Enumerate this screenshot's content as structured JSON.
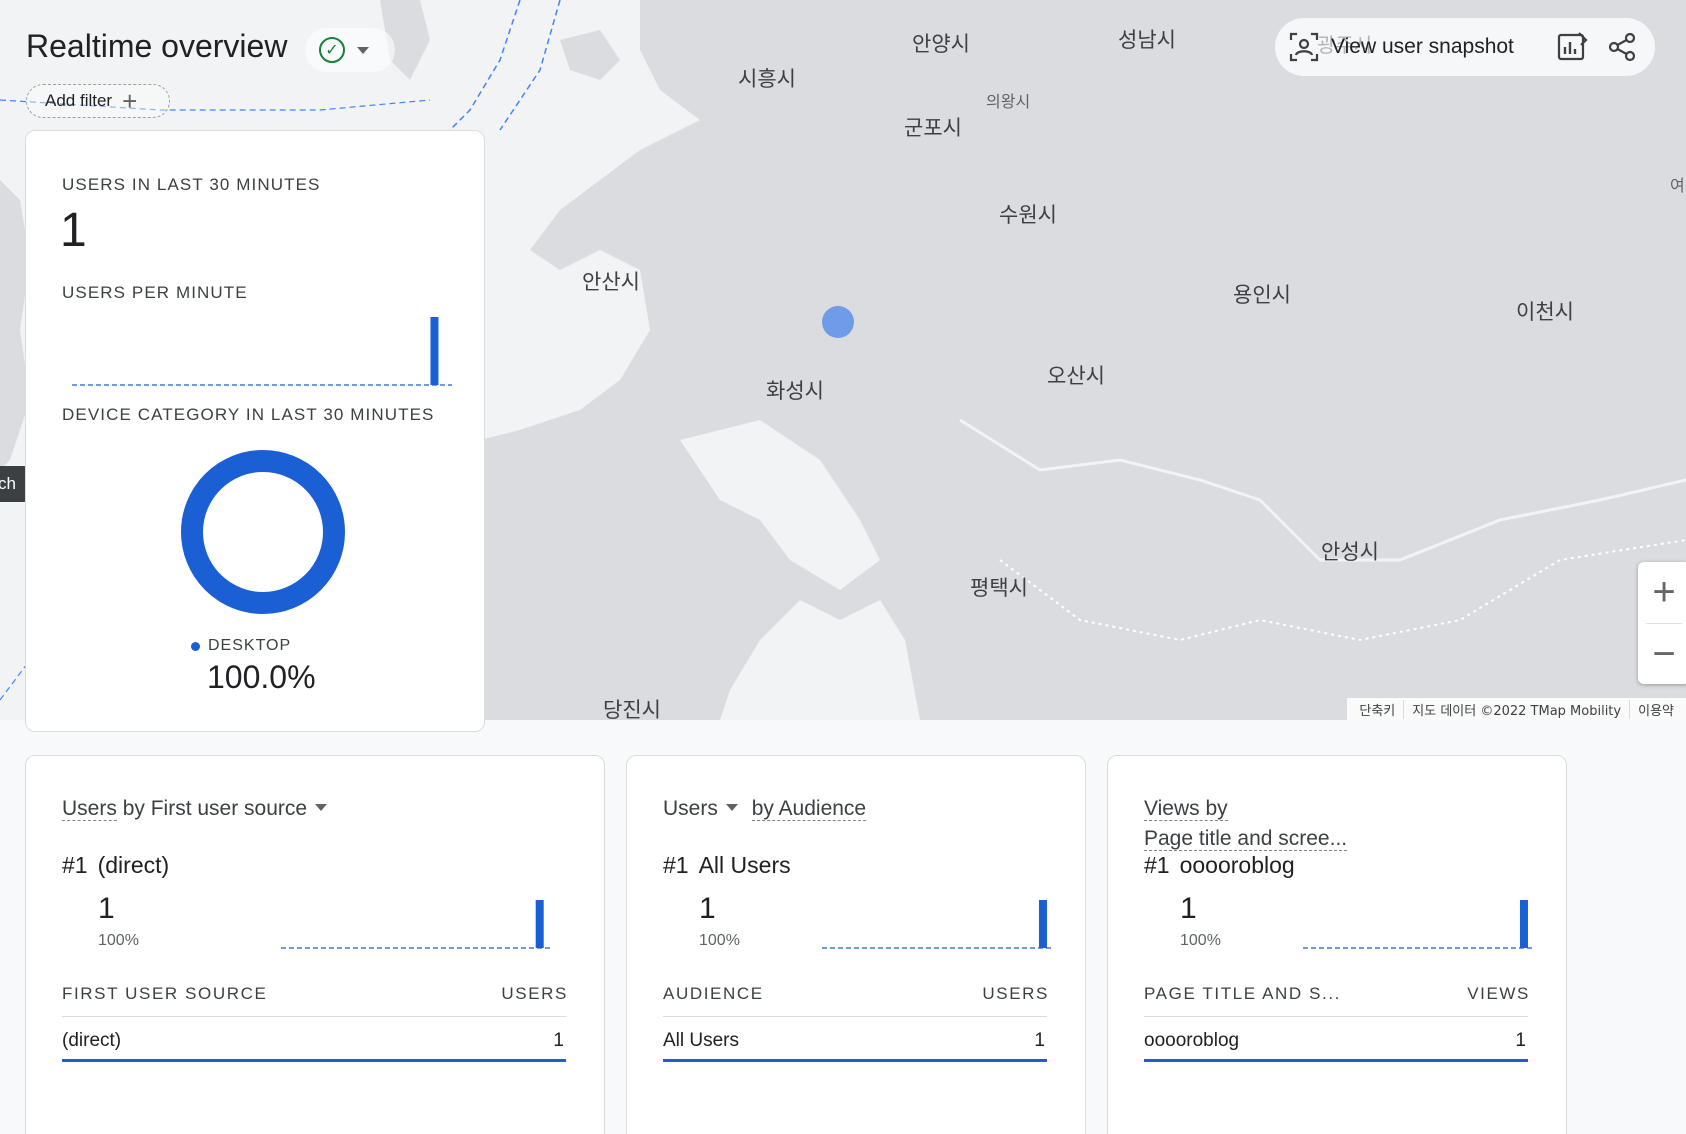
{
  "header": {
    "title": "Realtime overview",
    "add_filter": "Add filter",
    "view_snapshot": "View user snapshot",
    "behind_text": "광주시"
  },
  "side_tab": {
    "label": "ch"
  },
  "map": {
    "cities": [
      {
        "name": "안양시",
        "size": "normal"
      },
      {
        "name": "성남시",
        "size": "normal"
      },
      {
        "name": "시흥시",
        "size": "normal"
      },
      {
        "name": "의왕시",
        "size": "small"
      },
      {
        "name": "군포시",
        "size": "normal"
      },
      {
        "name": "수원시",
        "size": "normal"
      },
      {
        "name": "안산시",
        "size": "normal"
      },
      {
        "name": "용인시",
        "size": "normal"
      },
      {
        "name": "이천시",
        "size": "normal"
      },
      {
        "name": "화성시",
        "size": "normal"
      },
      {
        "name": "오산시",
        "size": "normal"
      },
      {
        "name": "안성시",
        "size": "normal"
      },
      {
        "name": "평택시",
        "size": "normal"
      },
      {
        "name": "당진시",
        "size": "normal"
      },
      {
        "name": "여",
        "size": "small"
      }
    ],
    "attribution": [
      "단축키",
      "지도 데이터 ©2022 TMap Mobility",
      "이용약"
    ],
    "zoom_in": "+",
    "zoom_out": "−"
  },
  "users_card": {
    "users_30_label": "USERS IN LAST 30 MINUTES",
    "users_30_value": "1",
    "per_minute_label": "USERS PER MINUTE",
    "device_label": "DEVICE CATEGORY IN LAST 30 MINUTES",
    "legend_label": "DESKTOP",
    "legend_pct": "100.0%"
  },
  "cards": [
    {
      "title_a": "Users",
      "title_b": "by First user source",
      "rank": "#1",
      "rank_name": "(direct)",
      "value": "1",
      "percent": "100%",
      "col1": "FIRST USER SOURCE",
      "col2": "USERS",
      "row_name": "(direct)",
      "row_value": "1"
    },
    {
      "title_a": "Users",
      "title_b": "by Audience",
      "rank": "#1",
      "rank_name": "All Users",
      "value": "1",
      "percent": "100%",
      "col1": "AUDIENCE",
      "col2": "USERS",
      "row_name": "All Users",
      "row_value": "1"
    },
    {
      "title_a": "Views by",
      "title_b": "Page title and scree...",
      "rank": "#1",
      "rank_name": "ooooroblog",
      "value": "1",
      "percent": "100%",
      "col1": "PAGE TITLE AND S...",
      "col2": "VIEWS",
      "row_name": "ooooroblog",
      "row_value": "1"
    }
  ],
  "chart_data": [
    {
      "type": "bar",
      "title": "USERS PER MINUTE",
      "categories": [
        "-29",
        "-28",
        "-27",
        "-26",
        "-25",
        "-24",
        "-23",
        "-22",
        "-21",
        "-20",
        "-19",
        "-18",
        "-17",
        "-16",
        "-15",
        "-14",
        "-13",
        "-12",
        "-11",
        "-10",
        "-9",
        "-8",
        "-7",
        "-6",
        "-5",
        "-4",
        "-3",
        "-2",
        "-1",
        "0"
      ],
      "values": [
        0,
        0,
        0,
        0,
        0,
        0,
        0,
        0,
        0,
        0,
        0,
        0,
        0,
        0,
        0,
        0,
        0,
        0,
        0,
        0,
        0,
        0,
        0,
        0,
        0,
        0,
        0,
        0,
        1,
        0
      ],
      "ylim": [
        0,
        1
      ],
      "color": "#1a5fd3"
    },
    {
      "type": "pie",
      "title": "DEVICE CATEGORY IN LAST 30 MINUTES",
      "categories": [
        "DESKTOP"
      ],
      "values": [
        100.0
      ],
      "color": "#1a5fd3"
    }
  ],
  "colors": {
    "accent": "#1a5fd3",
    "map_land": "#dadce0",
    "map_water": "#f1f3f4",
    "success": "#188038"
  }
}
